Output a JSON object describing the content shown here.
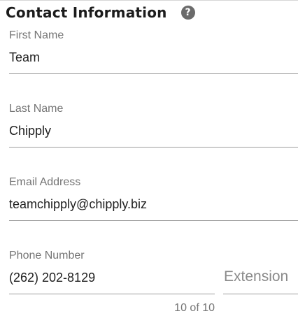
{
  "section": {
    "title": "Contact Information",
    "help_icon": "question-circle-icon"
  },
  "fields": {
    "first_name": {
      "label": "First Name",
      "value": "Team"
    },
    "last_name": {
      "label": "Last Name",
      "value": "Chipply"
    },
    "email": {
      "label": "Email Address",
      "value": "teamchipply@chipply.biz"
    },
    "phone": {
      "label": "Phone Number",
      "value": "(262) 202-8129",
      "counter": "10 of 10"
    },
    "extension": {
      "placeholder": "Extension",
      "value": ""
    }
  },
  "colors": {
    "title": "#1c1c1c",
    "label": "#757575",
    "value": "#212121",
    "underline": "#9e9e9e",
    "help_icon_bg": "#6b6b6b"
  }
}
